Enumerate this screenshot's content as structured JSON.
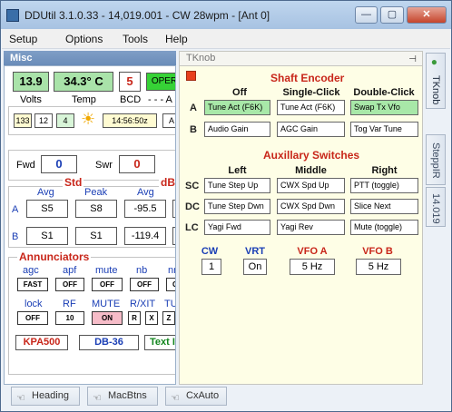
{
  "window": {
    "title": "DDUtil 3.1.0.33 - 14,019.001 - CW 28wpm - [Ant 0]",
    "controls": {
      "minimize": "—",
      "maximize": "▢",
      "close": "✕"
    }
  },
  "menu": [
    "Setup",
    "Options",
    "Tools",
    "Help"
  ],
  "misc": {
    "header": "Misc",
    "volts": "13.9",
    "volts_label": "Volts",
    "temp": "34.3° C",
    "temp_label": "Temp",
    "bcd": "5",
    "bcd_label": "BCD",
    "oper": "OPER",
    "dashes": "- - - A",
    "port_boxes": [
      "133",
      "12",
      "4"
    ],
    "sun_icon": "sun-icon",
    "time": "14:56:50z",
    "time_cut": "A",
    "fwd_label": "Fwd",
    "fwd": "0",
    "swr_label": "Swr",
    "swr": "0",
    "std_label": "Std",
    "dbm_label": "dBr",
    "col_avg": "Avg",
    "col_peak": "Peak",
    "col_avg2": "Avg",
    "row_a_label": "A",
    "row_a": [
      "S5",
      "S8",
      "-95.5"
    ],
    "row_b_label": "B",
    "row_b": [
      "S1",
      "S1",
      "-119.4"
    ],
    "annunciators_title": "Annunciators",
    "ann_row1_labels": [
      "agc",
      "apf",
      "mute",
      "nb",
      "nr"
    ],
    "ann_row1_values": [
      "FAST",
      "OFF",
      "OFF",
      "OFF",
      "OFF"
    ],
    "ann_row2_labels": [
      "lock",
      "RF",
      "MUTE",
      "R/XIT",
      "TU"
    ],
    "ann_row2_values": [
      "OFF",
      "10",
      "ON",
      "R",
      "X",
      "Z"
    ],
    "bottom_boxes": [
      "KPA500",
      "DB-36",
      "Text I"
    ]
  },
  "tknob": {
    "header": "TKnob",
    "pin_icon": "pin-icon",
    "shaft_title": "Shaft Encoder",
    "shaft_cols": [
      "Off",
      "Single-Click",
      "Double-Click"
    ],
    "shaft_rows": [
      {
        "label": "A",
        "cells": [
          "Tune Act (F6K)",
          "Tune Act (F6K)",
          "Swap Tx Vfo"
        ]
      },
      {
        "label": "B",
        "cells": [
          "Audio Gain",
          "AGC Gain",
          "Tog Var Tune"
        ]
      }
    ],
    "aux_title": "Auxillary Switches",
    "aux_cols": [
      "Left",
      "Middle",
      "Right"
    ],
    "aux_rows": [
      {
        "label": "SC",
        "cells": [
          "Tune Step Up",
          "CWX Spd Up",
          "PTT (toggle)"
        ]
      },
      {
        "label": "DC",
        "cells": [
          "Tune Step Dwn",
          "CWX Spd Dwn",
          "Slice Next"
        ]
      },
      {
        "label": "LC",
        "cells": [
          "Yagi Fwd",
          "Yagi Rev",
          "Mute (toggle)"
        ]
      }
    ],
    "fields": [
      {
        "label": "CW",
        "value": "1"
      },
      {
        "label": "VRT",
        "value": "On"
      },
      {
        "label": "VFO A",
        "value": "5 Hz"
      },
      {
        "label": "VFO B",
        "value": "5 Hz"
      }
    ]
  },
  "side_tabs": [
    "TKnob",
    "SteppIR",
    "14.019"
  ],
  "bottom_tabs": [
    "Heading",
    "MacBtns",
    "CxAuto"
  ],
  "colors": {
    "accent_red": "#c8261a",
    "green_box": "#a9e3a9",
    "pink": "#f6bcc8"
  }
}
